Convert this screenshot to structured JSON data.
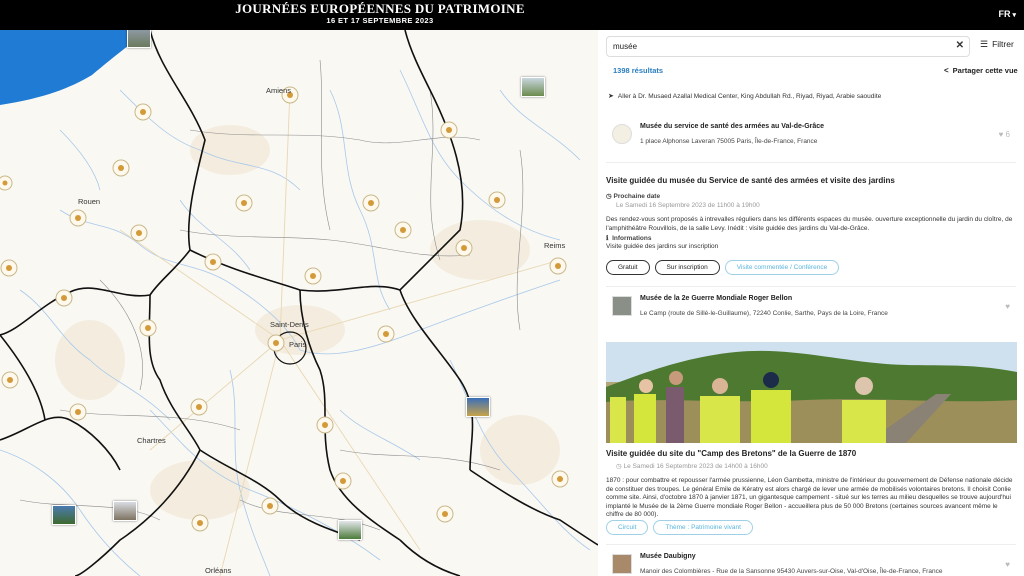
{
  "header": {
    "logo_title": "JOURNÉES EUROPÉENNES DU PATRIMOINE",
    "logo_subtitle": "16 ET 17 SEPTEMBRE 2023",
    "language": "FR"
  },
  "map": {
    "cities": [
      "Amiens",
      "Rouen",
      "Reims",
      "Saint-Denis",
      "Paris",
      "Chartres",
      "Orléans"
    ]
  },
  "search": {
    "value": "musée",
    "filter_label": "Filtrer"
  },
  "results": {
    "count_label": "1398 résultats",
    "share_label": "Partager cette vue",
    "navigation_text": "Aller à Dr. Musaed Azallal Medical Center, King Abdullah Rd., Riyad, Riyad, Arabie saoudite"
  },
  "places": [
    {
      "name": "Musée du service de santé des armées au Val-de-Grâce",
      "address": "1 place Alphonse Laveran 75005 Paris, Île-de-France, France",
      "likes": "6",
      "event": {
        "title": "Visite guidée du musée du Service de santé des armées et visite des jardins",
        "next_date_label": "Prochaine date",
        "date": "Le Samedi 16 Septembre 2023 de 11h00 à 19h00",
        "description": "Des rendez-vous sont proposés à intrevalles réguliers dans les différents espaces du musée. ouverture exceptionnelle du jardin du cloître, de l'amphithéâtre Rouvillois, de la salle Levy. Inédit : visite guidée des jardins du Val-de-Grâce.",
        "info_label": "Informations",
        "info_text": "Visite guidée des jardins sur inscription",
        "tags": [
          "Gratuit",
          "Sur inscription",
          "Visite commentée / Conférence"
        ]
      }
    },
    {
      "name": "Musée de la 2e Guerre Mondiale Roger Bellon",
      "address": "Le Camp (route de Sillé-le-Guillaume), 72240 Conlie, Sarthe, Pays de la Loire, France",
      "event": {
        "title": "Visite guidée du site du \"Camp des Bretons\" de la Guerre de 1870",
        "date": "Le Samedi 16 Septembre 2023 de 14h00 à 16h00",
        "description": "1870 : pour combattre et repousser l'armée prussienne, Léon Gambetta, ministre de l'intérieur du gouvernement de Défense nationale décide de constituer des troupes. Le général Emile de Kératry est alors chargé de lever une armée de mobilisés volontaires bretons. Il choisit Conlie comme site. Ainsi, d'octobre 1870 à janvier 1871, un gigantesque campement - situé sur les terres au milieu desquelles se trouve aujourd'hui implanté le Musée de la 2ème Guerre mondiale Roger Bellon - accueillera plus de 50 000 Bretons (certaines sources avancent même le chiffre de 80 000).",
        "tags": [
          "Circuit",
          "Thème : Patrimoine vivant"
        ]
      }
    },
    {
      "name": "Musée Daubigny",
      "address": "Manoir des Colombières - Rue de la Sansonne 95430 Auvers-sur-Oise, Val-d'Oise, Île-de-France, France"
    }
  ],
  "icons": {
    "clear": "close-icon",
    "filter": "sliders-icon",
    "share": "share-icon",
    "navigate": "navigation-arrow-icon",
    "like": "heart-icon",
    "clock": "clock-icon",
    "info": "info-icon"
  },
  "colors": {
    "header_bg": "#000000",
    "accent_blue": "#2a7ebf",
    "tag_blue": "#5bb5db",
    "sea": "#1f7bd4",
    "map_land": "#f9f8f3",
    "river": "#a8c8ea"
  }
}
